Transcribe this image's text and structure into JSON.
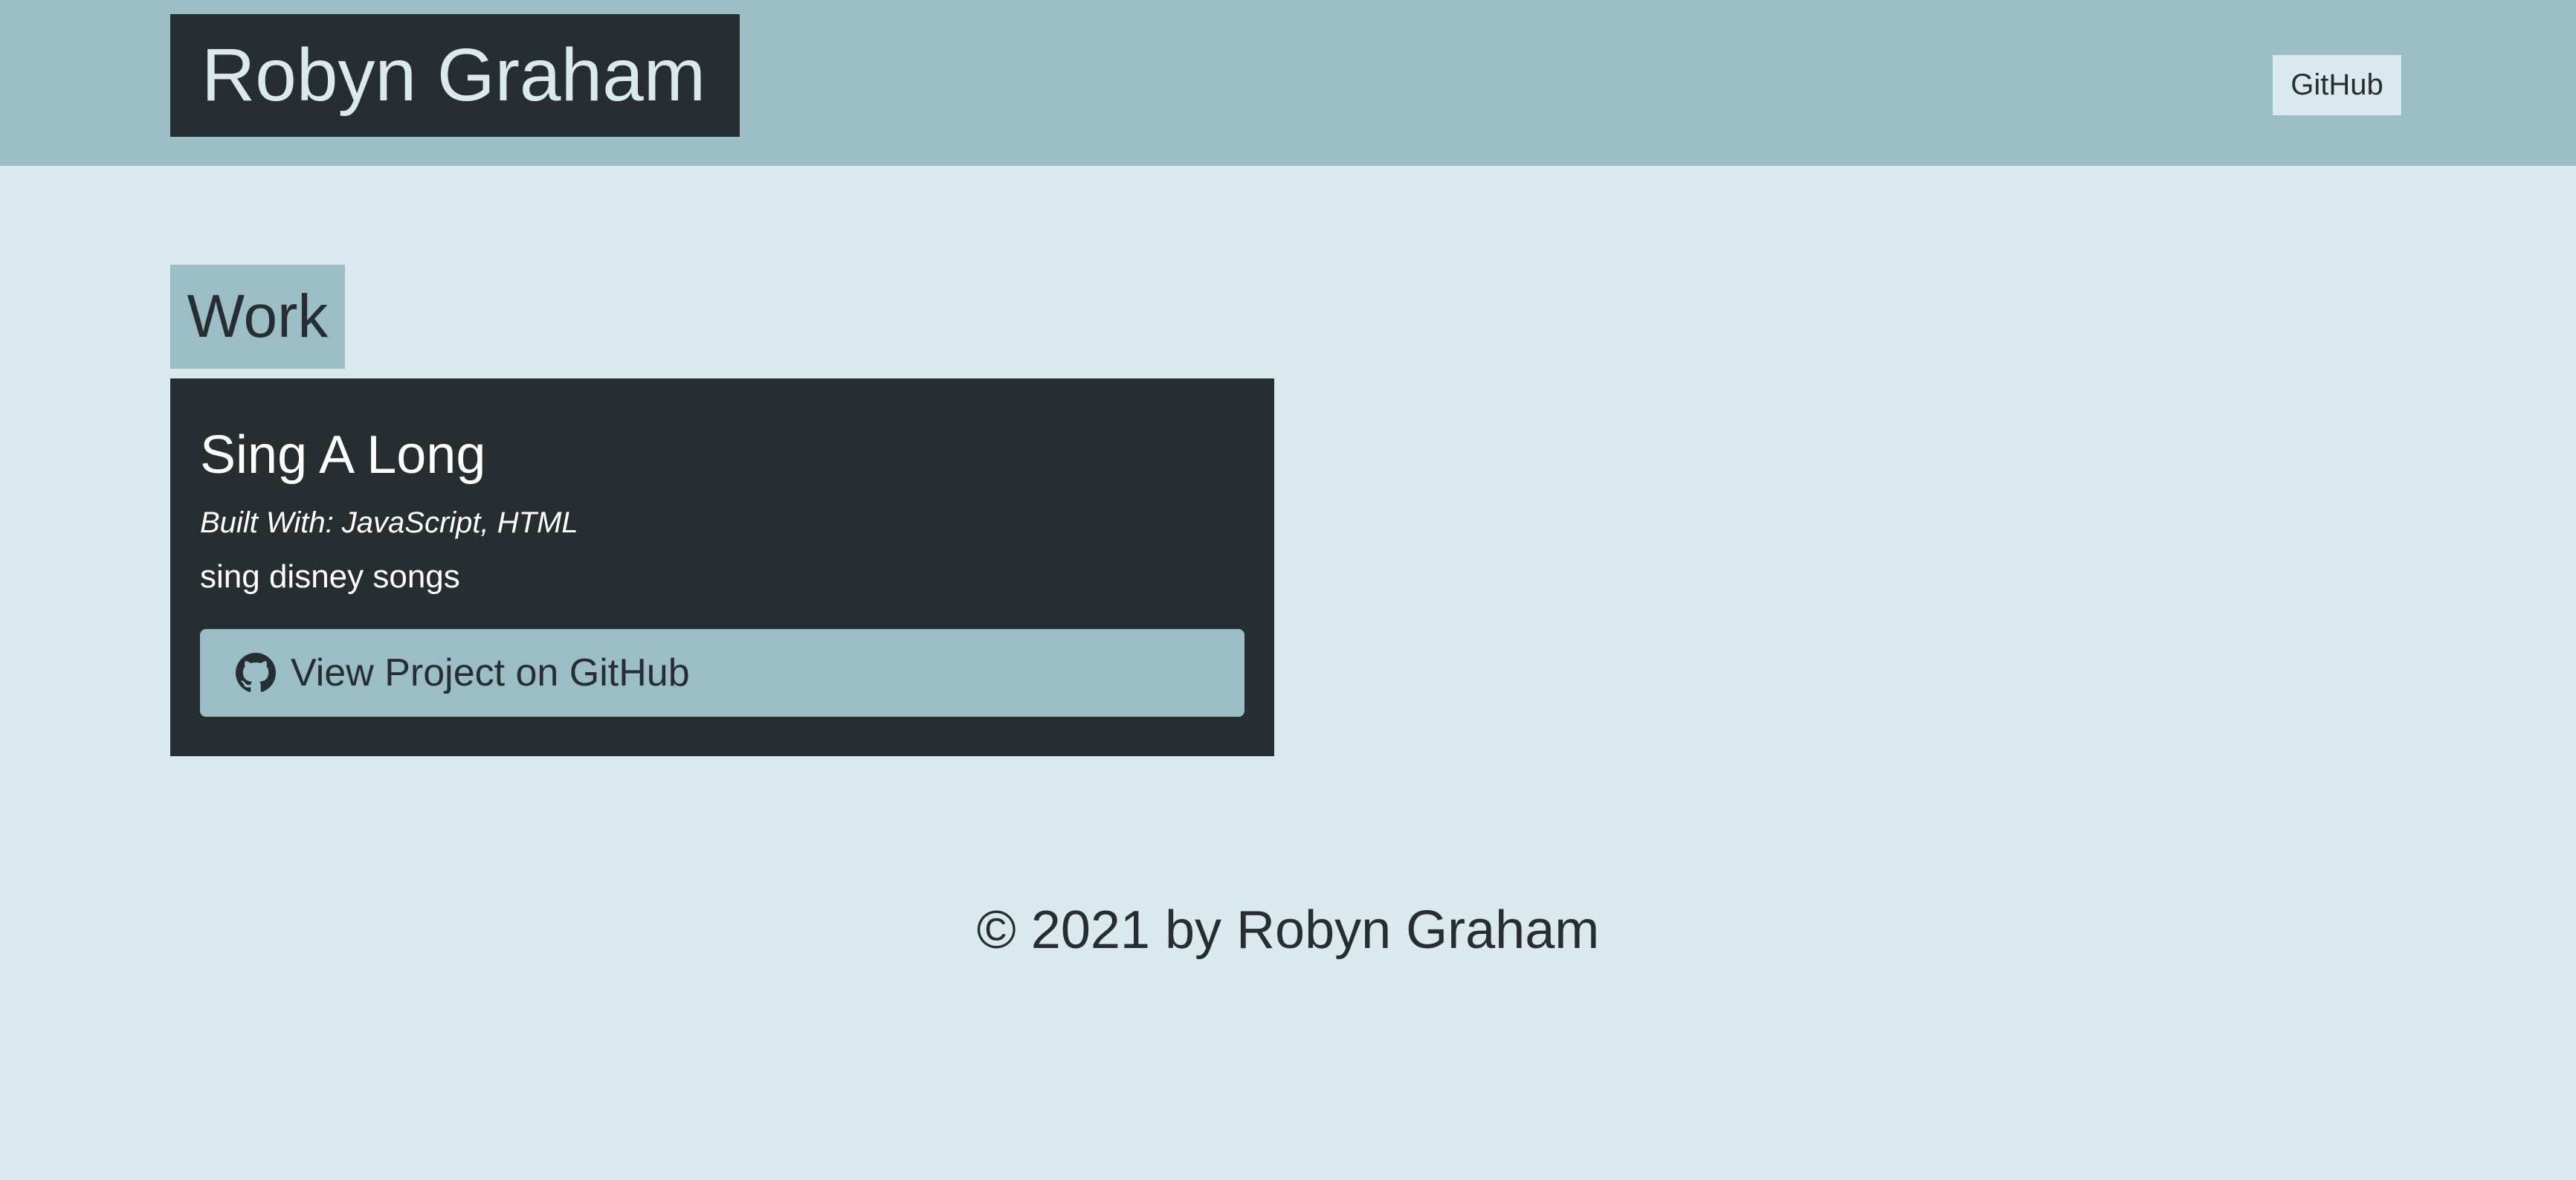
{
  "header": {
    "brand": "Robyn Graham",
    "nav_github": "GitHub"
  },
  "work": {
    "title": "Work",
    "projects": [
      {
        "title": "Sing A Long",
        "built_with": "Built With: JavaScript, HTML",
        "description": "sing disney songs",
        "button_label": "View Project on GitHub",
        "button_icon": "github-icon"
      }
    ]
  },
  "footer": {
    "copyright": "© 2021 by Robyn Graham"
  },
  "colors": {
    "header_bg": "#9bbdc6",
    "page_bg": "#dae9ee",
    "dark": "#272e32"
  }
}
